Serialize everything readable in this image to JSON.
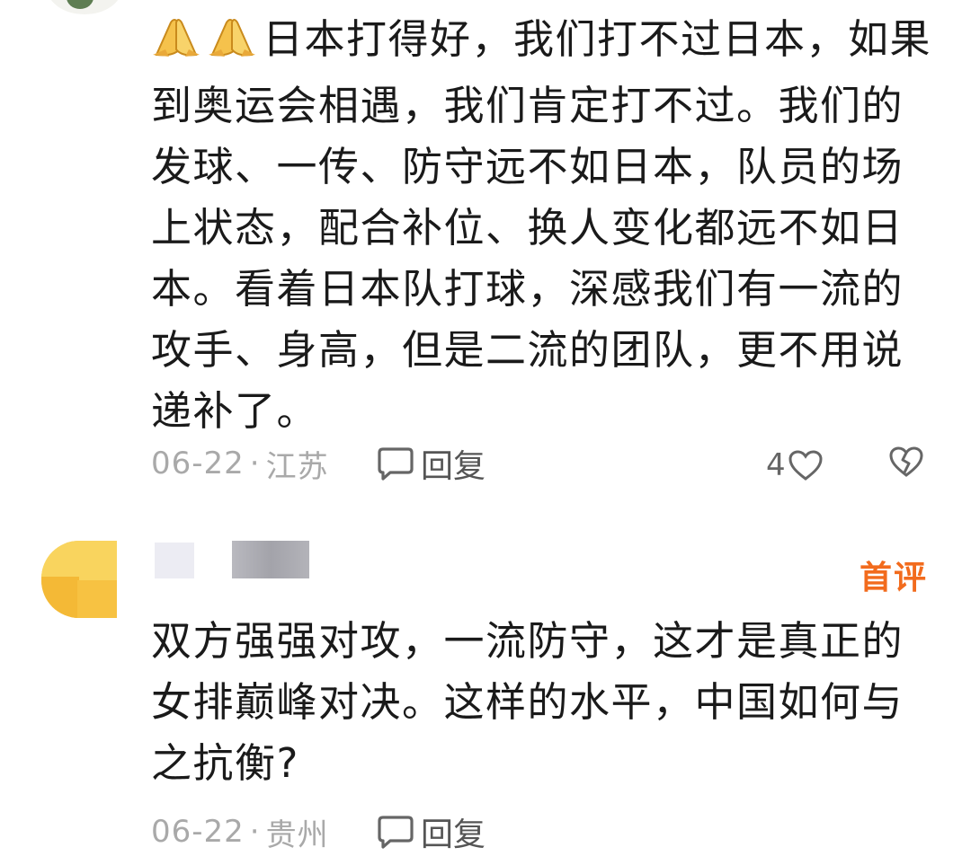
{
  "comments": [
    {
      "text": "日本打得好，我们打不过日本，如果到奥运会相遇，我们肯定打不过。我们的发球、一传、防守远不如日本，队员的场上状态，配合补位、换人变化都远不如日本。看着日本队打球，深感我们有一流的攻手、身高，但是二流的团队，更不用说递补了。",
      "date": "06-22",
      "separator": "·",
      "location": "江苏",
      "reply_label": "回复",
      "like_count": "4",
      "leading_emoji": [
        "folded-hands",
        "folded-hands"
      ]
    },
    {
      "badge": "首评",
      "text": "双方强强对攻，一流防守，这才是真正的女排巅峰对决。这样的水平，中国如何与之抗衡?",
      "date": "06-22",
      "separator": "·",
      "location": "贵州",
      "reply_label": "回复"
    }
  ],
  "colors": {
    "text": "#1a1a1a",
    "meta": "#a9a9a9",
    "badge": "#f26b1d"
  }
}
